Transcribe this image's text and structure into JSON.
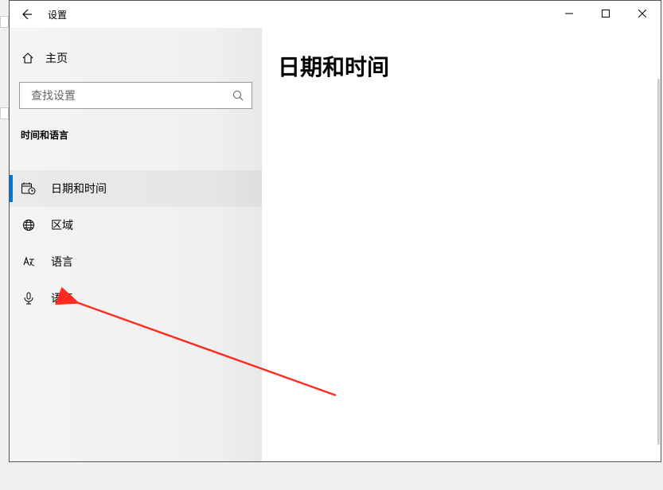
{
  "window": {
    "title": "设置"
  },
  "sidebar": {
    "home_label": "主页",
    "search_placeholder": "查找设置",
    "category": "时间和语言",
    "items": [
      {
        "label": "日期和时间"
      },
      {
        "label": "区域"
      },
      {
        "label": "语言"
      },
      {
        "label": "语音"
      }
    ]
  },
  "content": {
    "page_title": "日期和时间"
  },
  "annotation": {
    "arrow_color": "#ff2a20"
  }
}
